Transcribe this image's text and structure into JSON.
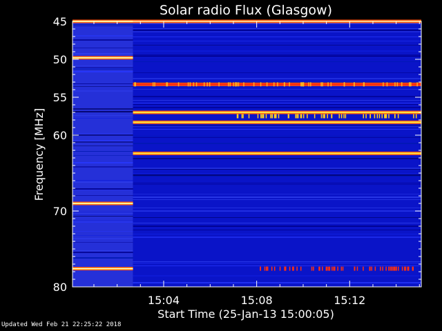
{
  "chart_data": {
    "type": "heatmap",
    "title": "Solar radio Flux (Glasgow)",
    "xlabel": "Start Time (25-Jan-13 15:00:05)",
    "ylabel": "Frequency [MHz]",
    "x_unit": "minutes after 15:00:05",
    "xlim": [
      0,
      15.0
    ],
    "ylim": [
      45,
      80
    ],
    "y_reversed": true,
    "y_ticks": [
      45,
      50,
      55,
      60,
      70,
      80
    ],
    "y_tick_labels": [
      "45",
      "50",
      "55",
      "60",
      "70",
      "80"
    ],
    "x_ticks": [
      3.92,
      7.92,
      11.92
    ],
    "x_tick_labels": [
      "15:04",
      "15:08",
      "15:12"
    ],
    "gap_end_minutes": 2.6,
    "colormap": [
      "#000020",
      "#0000a0",
      "#0a18ff",
      "#ff2020",
      "#ffa000",
      "#ffff60"
    ],
    "background_colors": {
      "segment1": "#2530d8",
      "segment2": "#0a14c8"
    },
    "bright_bands": [
      {
        "freq_mhz": 45.0,
        "start_min": 0.0,
        "end_min": 2.6,
        "level": "yellow"
      },
      {
        "freq_mhz": 45.0,
        "start_min": 2.6,
        "end_min": 15.0,
        "level": "orange"
      },
      {
        "freq_mhz": 49.8,
        "start_min": 0.0,
        "end_min": 2.6,
        "level": "yellow"
      },
      {
        "freq_mhz": 53.3,
        "start_min": 2.6,
        "end_min": 15.0,
        "level": "red"
      },
      {
        "freq_mhz": 57.0,
        "start_min": 2.6,
        "end_min": 15.0,
        "level": "yellow"
      },
      {
        "freq_mhz": 58.3,
        "start_min": 2.6,
        "end_min": 15.0,
        "level": "yellow"
      },
      {
        "freq_mhz": 62.4,
        "start_min": 2.6,
        "end_min": 15.0,
        "level": "yellow"
      },
      {
        "freq_mhz": 69.0,
        "start_min": 0.0,
        "end_min": 2.6,
        "level": "yellow"
      },
      {
        "freq_mhz": 77.6,
        "start_min": 0.0,
        "end_min": 2.6,
        "level": "yellow"
      }
    ]
  },
  "footer": "Updated Wed Feb 21 22:25:22 2018"
}
